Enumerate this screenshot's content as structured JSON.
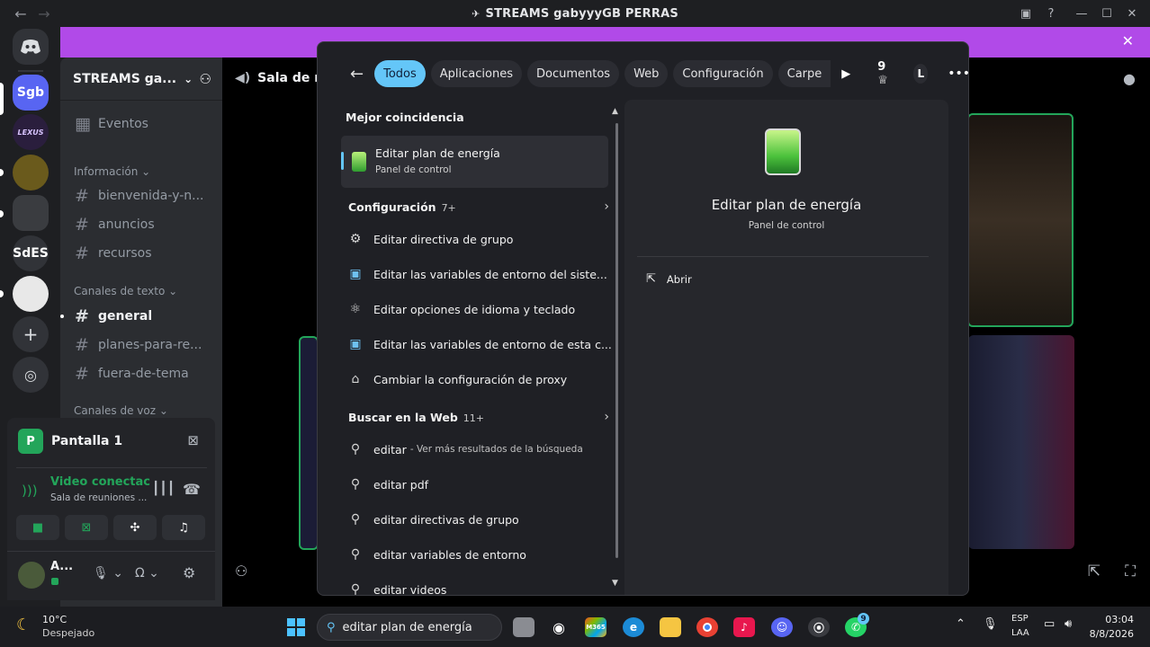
{
  "window": {
    "title": "STREAMS gabyyyGB PERRAS"
  },
  "rail": {
    "servers": [
      {
        "label": "Sgb"
      },
      {
        "label": "LEXUS"
      },
      {
        "label": ""
      },
      {
        "label": ""
      },
      {
        "label": "SdES"
      },
      {
        "label": ""
      }
    ]
  },
  "sidebar": {
    "guild_name": "STREAMS ga...",
    "events_label": "Eventos",
    "categories": [
      {
        "label": "Información"
      },
      {
        "label": "Canales de texto"
      },
      {
        "label": "Canales de voz"
      }
    ],
    "channels": [
      {
        "label": "bienvenida-y-n..."
      },
      {
        "label": "anuncios"
      },
      {
        "label": "recursos"
      },
      {
        "label": "general"
      },
      {
        "label": "planes-para-re..."
      },
      {
        "label": "fuera-de-tema"
      }
    ]
  },
  "voice_panel": {
    "stream_label": "Pantalla 1",
    "status": "Video conectac",
    "room": "Sala de reuniones ...",
    "user_initial": "A..."
  },
  "stage": {
    "channel_title": "Sala de re"
  },
  "search": {
    "filters": [
      "Todos",
      "Aplicaciones",
      "Documentos",
      "Web",
      "Configuración",
      "Carpe"
    ],
    "points": "9",
    "account_initial": "L",
    "best_match_header": "Mejor coincidencia",
    "best_match": {
      "title": "Editar plan de energía",
      "subtitle": "Panel de control"
    },
    "settings_header": "Configuración",
    "settings_count": "7+",
    "settings_items": [
      {
        "label": "Editar directiva de grupo",
        "icon": "gear-group-icon"
      },
      {
        "label": "Editar las variables de entorno del siste...",
        "icon": "monitor-icon"
      },
      {
        "label": "Editar opciones de idioma y teclado",
        "icon": "language-icon"
      },
      {
        "label": "Editar las variables de entorno de esta c...",
        "icon": "monitor-icon"
      },
      {
        "label": "Cambiar la configuración de proxy",
        "icon": "proxy-icon"
      }
    ],
    "web_header": "Buscar en la Web",
    "web_count": "11+",
    "web_items": [
      {
        "label": "editar",
        "sub": "- Ver más resultados de la búsqueda"
      },
      {
        "label": "editar pdf",
        "sub": ""
      },
      {
        "label": "editar directivas de grupo",
        "sub": ""
      },
      {
        "label": "editar variables de entorno",
        "sub": ""
      },
      {
        "label": "editar videos",
        "sub": ""
      }
    ],
    "preview": {
      "title": "Editar plan de energía",
      "subtitle": "Panel de control",
      "open_label": "Abrir"
    }
  },
  "taskbar": {
    "weather_temp": "10°C",
    "weather_desc": "Despejado",
    "search_text": "editar plan de energía",
    "lang_top": "ESP",
    "lang_bottom": "LAA",
    "time": "03:04",
    "date": "8/8/2026",
    "discord_badge": "",
    "whatsapp_badge": "9"
  },
  "colors": {
    "accent_blue": "#64c6f8",
    "banner_purple": "#b14ae8",
    "discord_green": "#23a55a"
  }
}
